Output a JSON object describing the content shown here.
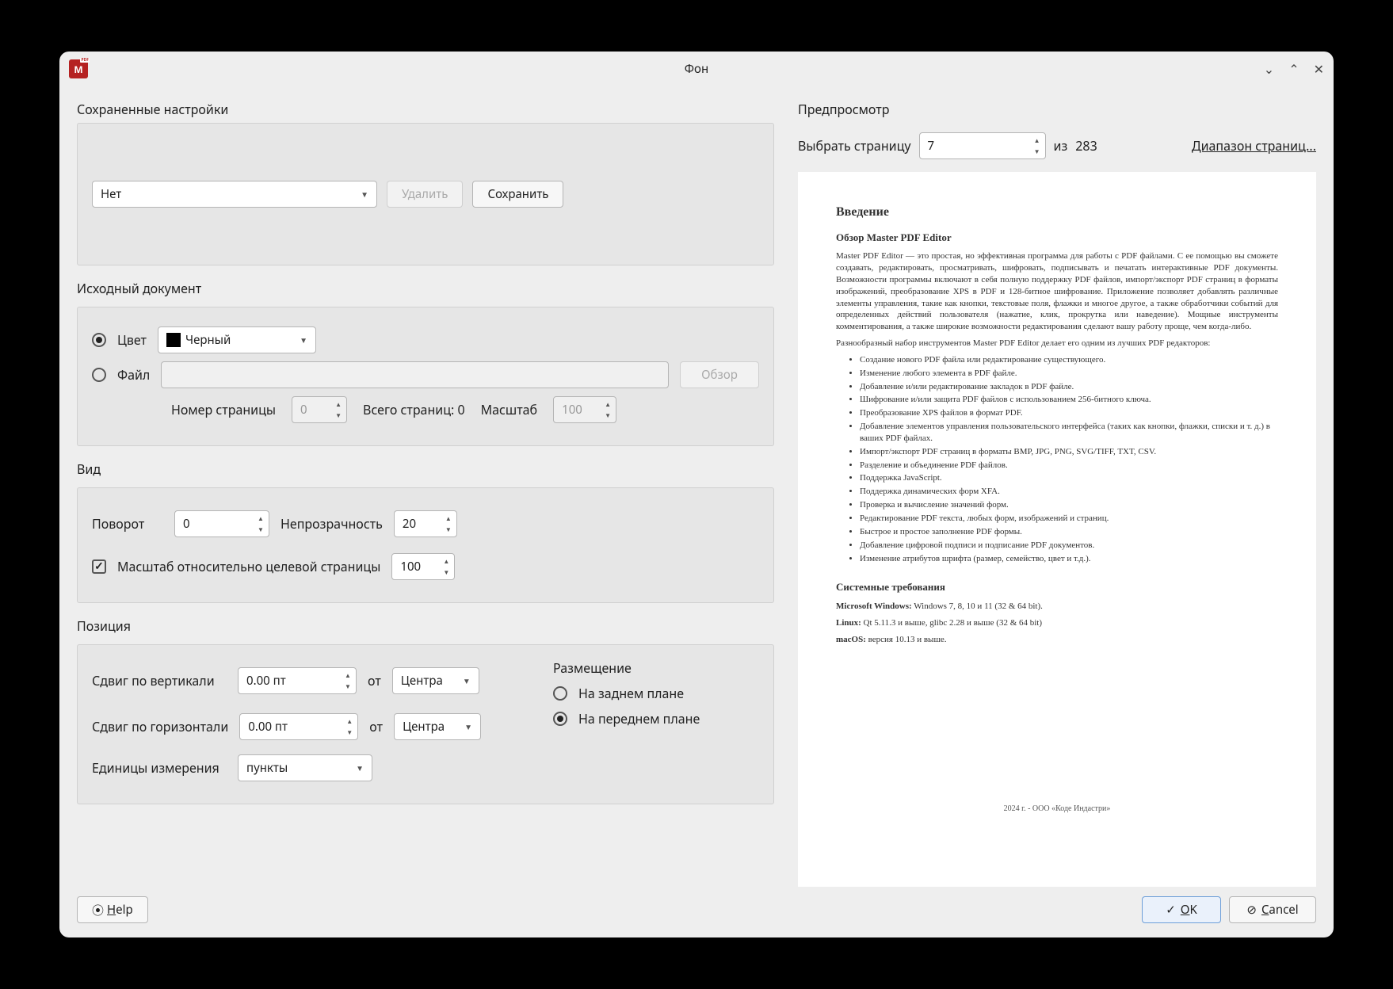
{
  "window": {
    "title": "Фон",
    "app_icon_letter": "M"
  },
  "saved": {
    "section_label": "Сохраненные настройки",
    "preset_value": "Нет",
    "delete_label": "Удалить",
    "save_label": "Сохранить"
  },
  "source": {
    "section_label": "Исходный документ",
    "color_label": "Цвет",
    "color_name": "Черный",
    "color_hex": "#000000",
    "file_label": "Файл",
    "file_value": "",
    "browse_label": "Обзор",
    "page_number_label": "Номер страницы",
    "page_number_value": "0",
    "total_pages_label": "Всего страниц: 0",
    "scale_label": "Масштаб",
    "scale_value": "100",
    "selected_radio": "color"
  },
  "view": {
    "section_label": "Вид",
    "rotation_label": "Поворот",
    "rotation_value": "0",
    "opacity_label": "Непрозрачность",
    "opacity_value": "20",
    "scale_rel_checked": true,
    "scale_rel_label": "Масштаб относительно целевой страницы",
    "scale_rel_value": "100"
  },
  "position": {
    "section_label": "Позиция",
    "v_offset_label": "Сдвиг по вертикали",
    "v_offset_value": "0.00 пт",
    "from_label": "от",
    "v_from_value": "Центра",
    "h_offset_label": "Сдвиг по горизонтали",
    "h_offset_value": "0.00 пт",
    "h_from_value": "Центра",
    "units_label": "Единицы измерения",
    "units_value": "пункты",
    "placement_label": "Размещение",
    "placement_back_label": "На заднем плане",
    "placement_front_label": "На переднем плане",
    "placement_selected": "front"
  },
  "preview": {
    "section_label": "Предпросмотр",
    "select_page_label": "Выбрать страницу",
    "page_value": "7",
    "of_label": "из",
    "total_pages": "283",
    "page_range_link": "Диапазон страниц...",
    "content": {
      "h2": "Введение",
      "h3_1": "Обзор Master PDF Editor",
      "p1": "Master PDF Editor — это простая, но эффективная программа для работы с PDF файлами. С ее помощью вы сможете создавать, редактировать, просматривать, шифровать, подписывать и печатать интерактивные PDF документы. Возможности программы включают в себя полную поддержку PDF файлов, импорт/экспорт PDF страниц в форматы изображений, преобразование XPS в PDF и 128-битное шифрование. Приложение позволяет добавлять различные элементы управления, такие как кнопки, текстовые поля, флажки и многое другое, а также обработчики событий для определенных действий пользователя (нажатие, клик, прокрутка или наведение). Мощные инструменты комментирования, а также широкие возможности редактирования сделают вашу работу проще, чем когда-либо.",
      "p2": "Разнообразный набор инструментов Master PDF Editor делает его одним из лучших PDF редакторов:",
      "bullets": [
        "Создание нового PDF файла или редактирование существующего.",
        "Изменение любого элемента в PDF файле.",
        "Добавление и/или редактирование закладок в PDF файле.",
        "Шифрование и/или защита PDF файлов с использованием 256-битного ключа.",
        "Преобразование XPS файлов в формат PDF.",
        "Добавление элементов управления пользовательского интерфейса (таких как кнопки, флажки, списки и т. д.) в ваших PDF файлах.",
        "Импорт/экспорт PDF страниц в форматы BMP, JPG, PNG, SVG/TIFF, TXT, CSV.",
        "Разделение и объединение PDF файлов.",
        "Поддержка JavaScript.",
        "Поддержка динамических форм XFA.",
        "Проверка и вычисление значений форм.",
        "Редактирование PDF текста, любых форм, изображений и страниц.",
        "Быстрое и простое заполнение PDF формы.",
        "Добавление цифровой подписи и подписание PDF документов.",
        "Изменение атрибутов шрифта (размер, семейство, цвет и т.д.)."
      ],
      "h3_2": "Системные требования",
      "req1_label": "Microsoft Windows:",
      "req1": " Windows 7, 8, 10 и 11 (32 & 64 bit).",
      "req2_label": "Linux:",
      "req2": " Qt 5.11.3 и выше, glibc 2.28 и выше (32 & 64 bit)",
      "req3_label": "macOS:",
      "req3": " версия 10.13 и выше.",
      "footer": "2024 г. - ООО «Коде Индастри»"
    }
  },
  "buttons": {
    "help_label": "Help",
    "ok_label": "OK",
    "cancel_label": "Cancel"
  }
}
